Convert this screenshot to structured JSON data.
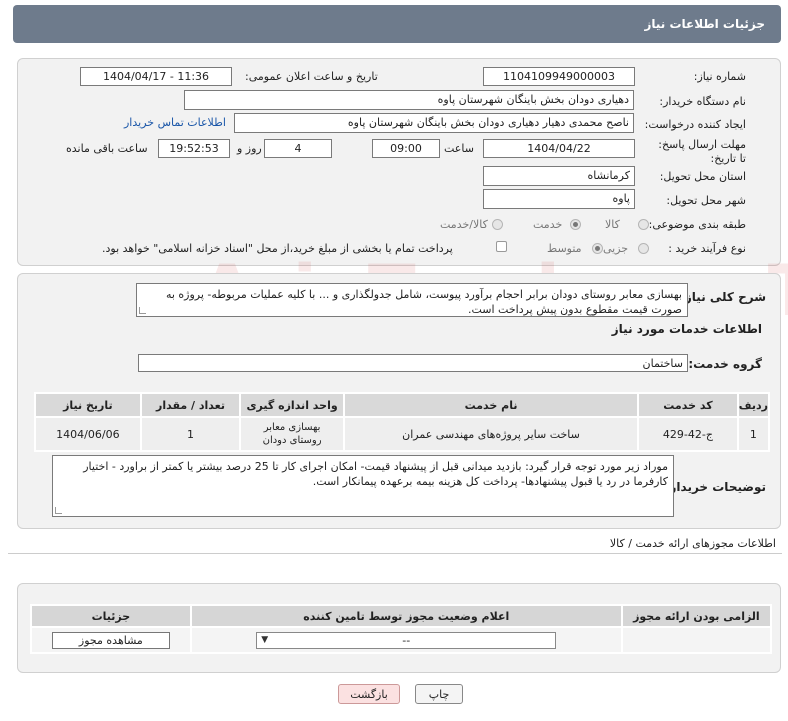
{
  "header": {
    "title": "جزئیات اطلاعات نیاز"
  },
  "form": {
    "need_number_label": "شماره نیاز:",
    "need_number": "1104109949000003",
    "announce_label": "تاریخ و ساعت اعلان عمومی:",
    "announce_value": "1404/04/17 - 11:36",
    "buyer_org_label": "نام دستگاه خریدار:",
    "buyer_org": "دهیاری دودان بخش باینگان شهرستان پاوه",
    "creator_label": "ایجاد کننده درخواست:",
    "creator": "ناصح محمدی دهیار دهیاری دودان بخش باینگان شهرستان پاوه",
    "contact_link": "اطلاعات تماس خریدار",
    "deadline_label": "مهلت ارسال پاسخ: تا تاریخ:",
    "deadline_date": "1404/04/22",
    "time_label": "ساعت",
    "deadline_time": "09:00",
    "days_value": "4",
    "days_label": "روز و",
    "remaining_time": "19:52:53",
    "remaining_label": "ساعت باقی مانده",
    "province_label": "استان محل تحویل:",
    "province": "کرمانشاه",
    "city_label": "شهر محل تحویل:",
    "city": "پاوه",
    "category_label": "طبقه بندی موضوعی:",
    "category_options": [
      "کالا",
      "خدمت",
      "کالا/خدمت"
    ],
    "process_label": "نوع فرآیند خرید :",
    "process_options": [
      "جزیی",
      "متوسط"
    ],
    "payment_note": "پرداخت تمام یا بخشی از مبلغ خرید،از محل \"اسناد خزانه اسلامی\" خواهد بود."
  },
  "summary": {
    "label": "شرح کلی نیاز:",
    "text": "بهسازی معابر روستای دودان برابر احجام برآورد پیوست، شامل جدولگذاری و ... با کلیه عملیات مربوطه- پروژه به صورت قیمت مقطوع بدون پیش پرداخت است."
  },
  "services": {
    "section_title": "اطلاعات خدمات مورد نیاز",
    "group_label": "گروه خدمت:",
    "group_value": "ساختمان",
    "columns": [
      "ردیف",
      "کد خدمت",
      "نام خدمت",
      "واحد اندازه گیری",
      "تعداد / مقدار",
      "تاریخ نیاز"
    ],
    "rows": [
      {
        "idx": "1",
        "code": "ج-42-429",
        "name": "ساخت سایر پروژه‌های مهندسی عمران",
        "unit": "بهسازی معابر روستای دودان",
        "qty": "1",
        "date": "1404/06/06"
      }
    ]
  },
  "buyer_notes": {
    "label": "توضیحات خریدار:",
    "text": "موراد زیر مورد توجه قرار گیرد: بازدید میدانی قبل از پیشنهاد قیمت- امکان اجرای کار تا 25 درصد بیشتر یا کمتر از براورد - اختیار کارفرما در رد یا قبول پیشنهادها- پرداخت کل هزینه بیمه برعهده پیمانکار است."
  },
  "licenses": {
    "section_title": "اطلاعات مجوزهای ارائه خدمت / کالا",
    "columns": [
      "الزامی بودن ارائه مجوز",
      "اعلام وضعیت مجوز توسط تامین کننده",
      "جزئیات"
    ],
    "select_value": "--",
    "view_button": "مشاهده مجوز"
  },
  "actions": {
    "print": "چاپ",
    "back": "بازگشت"
  },
  "watermark": "AriaTender.neT"
}
